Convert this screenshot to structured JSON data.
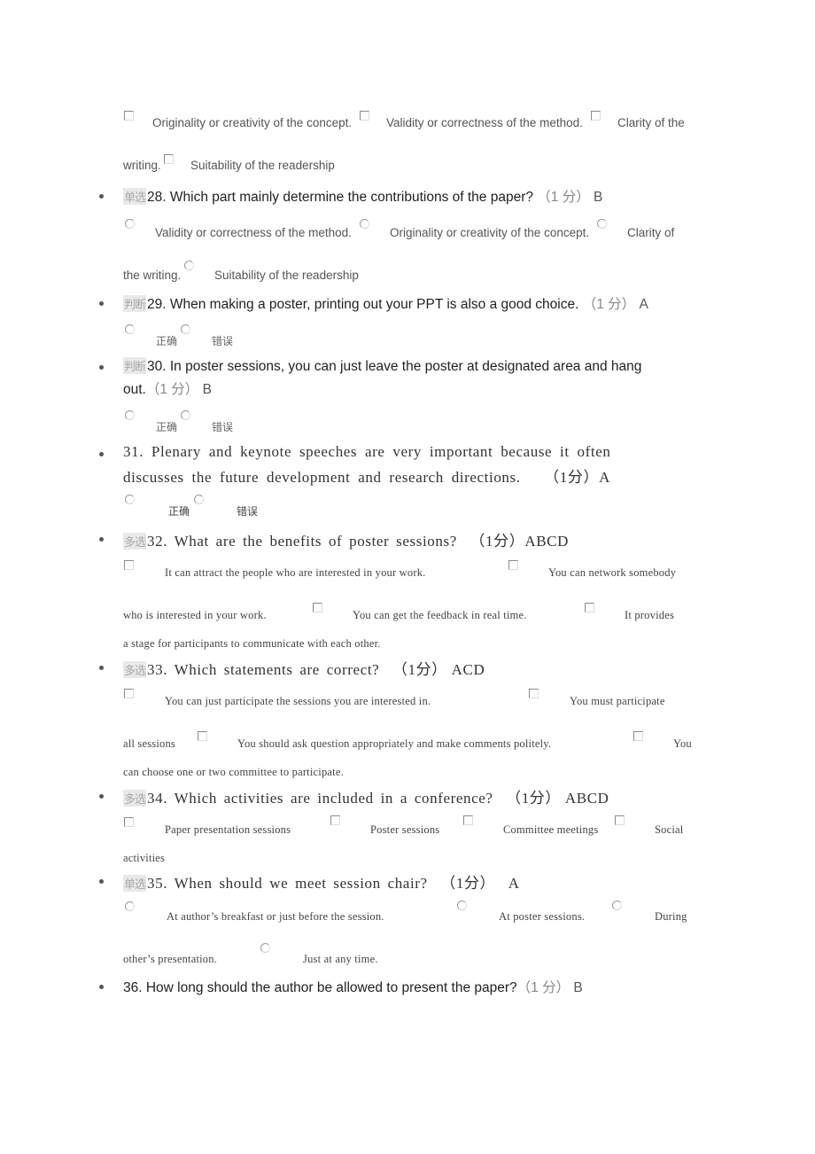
{
  "q27": {
    "options": [
      "Originality or creativity of the concept.",
      "Validity or correctness of the method.",
      "Clarity of the",
      "writing.",
      "Suitability of the readership"
    ]
  },
  "q28": {
    "tag": "单选",
    "text": "28. Which part mainly determine the contributions of the paper?",
    "points": "（1 分）",
    "answer": "B",
    "options": [
      "Validity or correctness of the method.",
      "Originality or creativity of the concept.",
      "Clarity of",
      "the writing.",
      "Suitability of the readership"
    ]
  },
  "q29": {
    "tag": "判断",
    "text": "29. When making a poster, printing out your PPT is also a good choice.",
    "points": "（1 分）",
    "answer": "A",
    "options": [
      "正确",
      "错误"
    ]
  },
  "q30": {
    "tag": "判断",
    "text_line1": "30. In poster sessions, you can just leave the poster at designated area and hang",
    "text_line2": "out.",
    "points": "（1 分）",
    "answer": "B",
    "options": [
      "正确",
      "错误"
    ]
  },
  "q31": {
    "text_line1": "31.  Plenary and keynote speeches are very important because it often",
    "text_line2": "discusses the future development and research directions.",
    "points": "（1分）",
    "answer": "A",
    "options": [
      "正确",
      "错误"
    ]
  },
  "q32": {
    "tag": "多选",
    "text": "32.  What are the benefits of poster sessions?",
    "points": "（1分）",
    "answer": "ABCD",
    "options": [
      "It can attract the people who are interested in your work.",
      "You can network somebody",
      "who is interested in your work.",
      "You can get the feedback in real time.",
      "It provides",
      "a stage for participants to communicate with each other."
    ]
  },
  "q33": {
    "tag": "多选",
    "text": "33.  Which statements are correct?",
    "points": "（1分）",
    "answer": "ACD",
    "options": [
      "You can just participate the sessions you are interested in.",
      "You must participate",
      "all sessions",
      "You should ask question appropriately and make comments politely.",
      "You",
      "can choose one or two committee to participate."
    ]
  },
  "q34": {
    "tag": "多选",
    "text": "34.  Which activities are included in a conference?",
    "points": "（1分）",
    "answer": "ABCD",
    "options": [
      "Paper presentation sessions",
      "Poster sessions",
      "Committee meetings",
      "Social",
      "activities"
    ]
  },
  "q35": {
    "tag": "单选",
    "text": "35.  When should we meet session chair?",
    "points": "（1分）",
    "answer": "A",
    "options": [
      "At author’s breakfast or just before the session.",
      "At poster sessions.",
      "During",
      "other’s presentation.",
      "Just at any time."
    ]
  },
  "q36": {
    "text": "36. How long should the author be allowed to present the paper?",
    "points": "（1 分）",
    "answer": "B"
  }
}
